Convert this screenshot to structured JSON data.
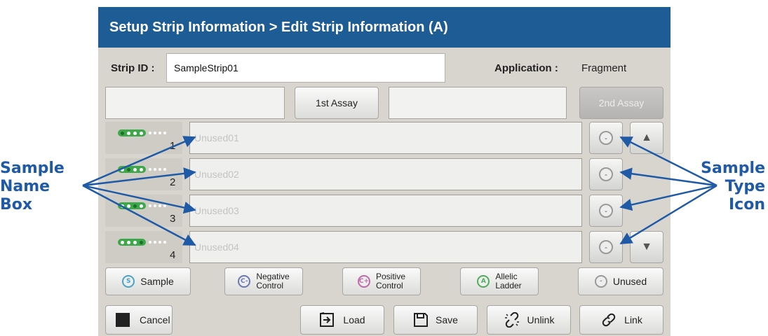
{
  "callouts": {
    "left": [
      "Sample",
      "Name",
      "Box"
    ],
    "right": [
      "Sample",
      "Type",
      "Icon"
    ]
  },
  "header": {
    "title": "Setup Strip Information > Edit Strip Information (A)"
  },
  "strip": {
    "id_label": "Strip ID :",
    "id_value": "SampleStrip01",
    "application_label": "Application :",
    "application_value": "Fragment"
  },
  "assay": {
    "first_label": "1st Assay",
    "second_label": "2nd Assay"
  },
  "wells": [
    {
      "number": "1",
      "placeholder": "Unused01",
      "active_index": 0,
      "type_symbol": "-"
    },
    {
      "number": "2",
      "placeholder": "Unused02",
      "active_index": 1,
      "type_symbol": "-"
    },
    {
      "number": "3",
      "placeholder": "Unused03",
      "active_index": 2,
      "type_symbol": "-"
    },
    {
      "number": "4",
      "placeholder": "Unused04",
      "active_index": 3,
      "type_symbol": "-"
    }
  ],
  "legend": [
    {
      "symbol": "S",
      "lines": [
        "Sample"
      ],
      "color": "#4aa3c9"
    },
    {
      "symbol": "C-",
      "lines": [
        "Negative",
        "Control"
      ],
      "color": "#6a78b8"
    },
    {
      "symbol": "C+",
      "lines": [
        "Positive",
        "Control"
      ],
      "color": "#c06aa8"
    },
    {
      "symbol": "A",
      "lines": [
        "Allelic",
        "Ladder"
      ],
      "color": "#4fae5a"
    },
    {
      "symbol": "-",
      "lines": [
        "Unused"
      ],
      "color": "#9a9a9a"
    }
  ],
  "actions": {
    "cancel": "Cancel",
    "load": "Load",
    "save": "Save",
    "unlink": "Unlink",
    "link": "Link"
  },
  "colors": {
    "header_bg": "#1d5c94",
    "panel_bg": "#d8d5cf",
    "callout": "#1f5aa6"
  }
}
